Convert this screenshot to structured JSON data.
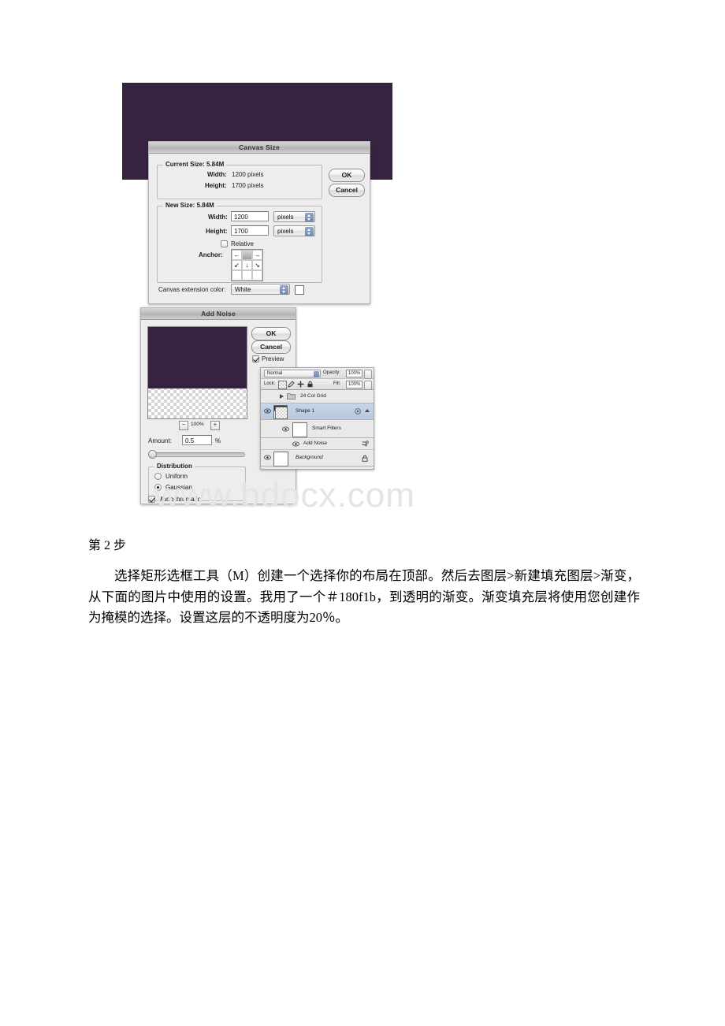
{
  "document": {
    "heading": "第 2 步",
    "paragraph": "选择矩形选框工具（M）创建一个选择你的布局在顶部。然后去图层>新建填充图层>渐变，从下面的图片中使用的设置。我用了一个＃180f1b，到透明的渐变。渐变填充层将使用您创建作为掩模的选择。设置这层的不透明度为20％。"
  },
  "watermark": {
    "text": "www.bdocx.com"
  },
  "canvas_image": {
    "color": "#372240"
  },
  "canvas_size_dialog": {
    "title": "Canvas Size",
    "current_size": {
      "group_label": "Current Size: 5.84M",
      "width_label": "Width:",
      "width_value": "1200 pixels",
      "height_label": "Height:",
      "height_value": "1700 pixels"
    },
    "new_size": {
      "group_label": "New Size: 5.84M",
      "width_label": "Width:",
      "width_value": "1200",
      "width_units": "pixels",
      "height_label": "Height:",
      "height_value": "1700",
      "height_units": "pixels",
      "relative_label": "Relative",
      "relative_checked": false,
      "anchor_label": "Anchor:",
      "anchor_cells": [
        "←",
        "",
        "→",
        "↙",
        "↓",
        "↘",
        "",
        "",
        ""
      ]
    },
    "extension": {
      "label": "Canvas extension color:",
      "value": "White",
      "swatch_color": "#ffffff"
    },
    "buttons": {
      "ok": "OK",
      "cancel": "Cancel"
    }
  },
  "add_noise_dialog": {
    "title": "Add Noise",
    "buttons": {
      "ok": "OK",
      "cancel": "Cancel"
    },
    "preview_label": "Preview",
    "preview_checked": true,
    "zoom_level": "100%",
    "zoom_out": "−",
    "zoom_in": "+",
    "amount_label": "Amount:",
    "amount_value": "0.5",
    "amount_unit": "%",
    "distribution": {
      "group_label": "Distribution",
      "uniform_label": "Uniform",
      "gaussian_label": "Gaussian",
      "selected": "Gaussian"
    },
    "monochromatic_label": "Monochromatic",
    "monochromatic_checked": true
  },
  "layers_panel": {
    "blend_mode": "Normal",
    "opacity_label": "Opacity:",
    "opacity_value": "100%",
    "lock_label": "Lock:",
    "fill_label": "Fill:",
    "fill_value": "100%",
    "rows": [
      {
        "name": "24 Col Grid",
        "type": "group"
      },
      {
        "name": "Shape 1",
        "type": "layer",
        "selected": true
      },
      {
        "name": "Smart Filters",
        "type": "smart-filters"
      },
      {
        "name": "Add Noise",
        "type": "filter"
      },
      {
        "name": "Background",
        "type": "layer",
        "locked": true
      }
    ]
  }
}
